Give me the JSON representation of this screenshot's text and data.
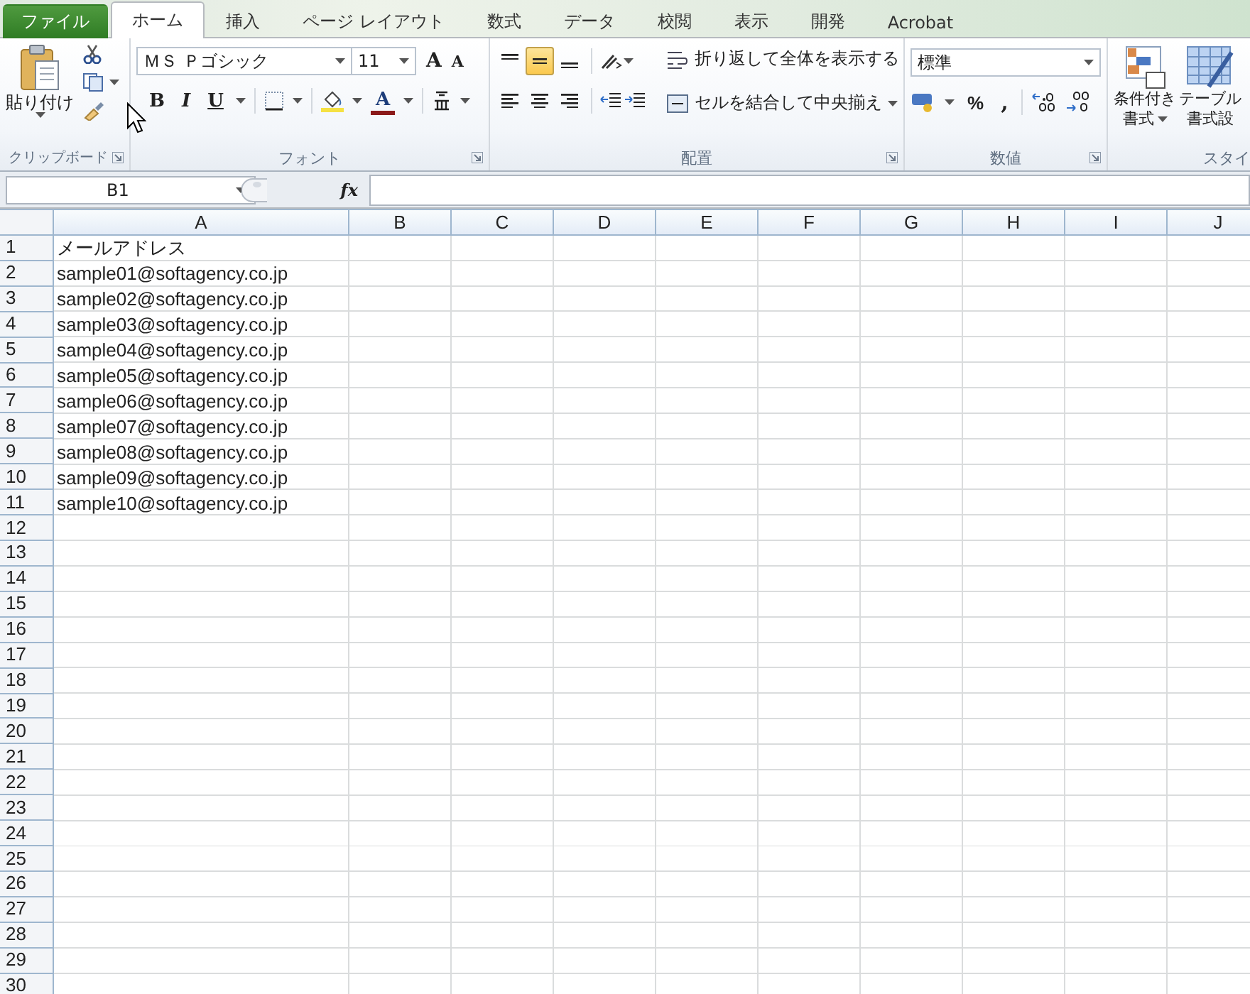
{
  "tabs": [
    {
      "label": "ファイル",
      "kind": "file",
      "selected": false
    },
    {
      "label": "ホーム",
      "kind": "tab",
      "selected": true
    },
    {
      "label": "挿入",
      "kind": "tab",
      "selected": false
    },
    {
      "label": "ページ レイアウト",
      "kind": "tab",
      "selected": false
    },
    {
      "label": "数式",
      "kind": "tab",
      "selected": false
    },
    {
      "label": "データ",
      "kind": "tab",
      "selected": false
    },
    {
      "label": "校閲",
      "kind": "tab",
      "selected": false
    },
    {
      "label": "表示",
      "kind": "tab",
      "selected": false
    },
    {
      "label": "開発",
      "kind": "tab",
      "selected": false
    },
    {
      "label": "Acrobat",
      "kind": "tab",
      "selected": false
    }
  ],
  "ribbon": {
    "clipboard": {
      "paste": "貼り付け",
      "label": "クリップボード"
    },
    "font": {
      "name": "ＭＳ Ｐゴシック",
      "size": "11",
      "grow": "A",
      "shrink": "A",
      "bold": "B",
      "italic": "I",
      "underline": "U",
      "font_color": "A",
      "label": "フォント"
    },
    "alignment": {
      "vertical": [
        {
          "kind": "top",
          "selected": false
        },
        {
          "kind": "middle",
          "selected": true
        },
        {
          "kind": "bottom",
          "selected": false
        }
      ],
      "horizontal": [
        {
          "kind": "left",
          "selected": false
        },
        {
          "kind": "center",
          "selected": false
        },
        {
          "kind": "right",
          "selected": false
        }
      ],
      "wrap": "折り返して全体を表示する",
      "merge": "セルを結合して中央揃え",
      "label": "配置"
    },
    "number": {
      "format": "標準",
      "percent": "%",
      "comma": ",",
      "label": "数値"
    },
    "styles": {
      "conditional": [
        "条件付き",
        "書式"
      ],
      "table": [
        "テーブル",
        "書式設"
      ],
      "label": "スタイ"
    }
  },
  "formula_bar": {
    "name_box": "B1",
    "fx": "fx"
  },
  "sheet": {
    "columns": [
      "A",
      "B",
      "C",
      "D",
      "E",
      "F",
      "G",
      "H",
      "I",
      "J"
    ],
    "rows": [
      {
        "header": "1",
        "cells": [
          "メールアドレス"
        ]
      },
      {
        "header": "2",
        "cells": [
          "sample01@softagency.co.jp"
        ]
      },
      {
        "header": "3",
        "cells": [
          "sample02@softagency.co.jp"
        ]
      },
      {
        "header": "4",
        "cells": [
          "sample03@softagency.co.jp"
        ]
      },
      {
        "header": "5",
        "cells": [
          "sample04@softagency.co.jp"
        ]
      },
      {
        "header": "6",
        "cells": [
          "sample05@softagency.co.jp"
        ]
      },
      {
        "header": "7",
        "cells": [
          "sample06@softagency.co.jp"
        ]
      },
      {
        "header": "8",
        "cells": [
          "sample07@softagency.co.jp"
        ]
      },
      {
        "header": "9",
        "cells": [
          "sample08@softagency.co.jp"
        ]
      },
      {
        "header": "10",
        "cells": [
          "sample09@softagency.co.jp"
        ]
      },
      {
        "header": "11",
        "cells": [
          "sample10@softagency.co.jp"
        ]
      },
      {
        "header": "12"
      },
      {
        "header": "13"
      },
      {
        "header": "14"
      },
      {
        "header": "15"
      },
      {
        "header": "16"
      },
      {
        "header": "17"
      },
      {
        "header": "18"
      },
      {
        "header": "19"
      },
      {
        "header": "20"
      },
      {
        "header": "21"
      },
      {
        "header": "22"
      },
      {
        "header": "23"
      },
      {
        "header": "24"
      },
      {
        "header": "25"
      },
      {
        "header": "26"
      },
      {
        "header": "27"
      },
      {
        "header": "28"
      },
      {
        "header": "29"
      },
      {
        "header": "30"
      }
    ]
  }
}
